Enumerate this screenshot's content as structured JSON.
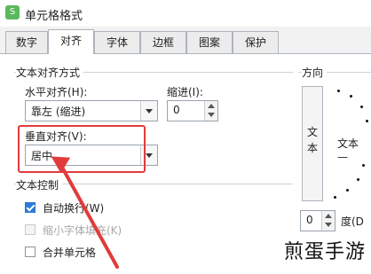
{
  "window": {
    "title": "单元格格式",
    "app_icon_glyph": "S"
  },
  "tabs": [
    {
      "label": "数字",
      "active": false
    },
    {
      "label": "对齐",
      "active": true
    },
    {
      "label": "字体",
      "active": false
    },
    {
      "label": "边框",
      "active": false
    },
    {
      "label": "图案",
      "active": false
    },
    {
      "label": "保护",
      "active": false
    }
  ],
  "alignment": {
    "group_title": "文本对齐方式",
    "horizontal_label": "水平对齐(H):",
    "horizontal_value": "靠左 (缩进)",
    "indent_label": "缩进(I):",
    "indent_value": "0",
    "vertical_label": "垂直对齐(V):",
    "vertical_value": "居中"
  },
  "text_control": {
    "group_title": "文本控制",
    "wrap_text": {
      "label": "自动换行(W)",
      "checked": true,
      "enabled": true
    },
    "shrink_to_fit": {
      "label": "缩小字体填充(K)",
      "checked": false,
      "enabled": false
    },
    "merge_cells": {
      "label": "合并单元格",
      "checked": false,
      "enabled": true
    }
  },
  "orientation": {
    "group_title": "方向",
    "vertical_text_button": "文本",
    "dial_text": "文本 —",
    "degree_value": "0",
    "degree_label": "度(D"
  },
  "annotation": {
    "highlight_color": "#e23b3b",
    "arrow_color": "#e23b3b"
  },
  "watermark": "煎蛋手游"
}
